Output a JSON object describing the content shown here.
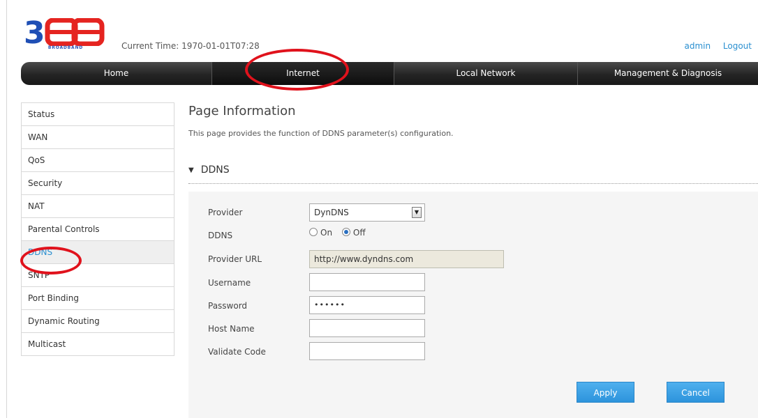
{
  "brand": {
    "logo_text": "3BB",
    "logo_sub": "BROADBAND",
    "colors": {
      "logo_blue": "#1f4fb5",
      "logo_red": "#e52420"
    }
  },
  "header": {
    "current_time": "Current Time: 1970-01-01T07:28",
    "admin": "admin",
    "logout": "Logout"
  },
  "nav": [
    {
      "label": "Home"
    },
    {
      "label": "Internet"
    },
    {
      "label": "Local Network"
    },
    {
      "label": "Management & Diagnosis"
    }
  ],
  "sidebar": {
    "items": [
      {
        "label": "Status"
      },
      {
        "label": "WAN"
      },
      {
        "label": "QoS"
      },
      {
        "label": "Security"
      },
      {
        "label": "NAT"
      },
      {
        "label": "Parental Controls"
      },
      {
        "label": "DDNS"
      },
      {
        "label": "SNTP"
      },
      {
        "label": "Port Binding"
      },
      {
        "label": "Dynamic Routing"
      },
      {
        "label": "Multicast"
      }
    ]
  },
  "main": {
    "heading": "Page Information",
    "description": "This page provides the function of DDNS parameter(s) configuration.",
    "section_title": "DDNS",
    "form": {
      "provider_label": "Provider",
      "provider_value": "DynDNS",
      "ddns_label": "DDNS",
      "ddns_on": "On",
      "ddns_off": "Off",
      "provider_url_label": "Provider URL",
      "provider_url_value": "http://www.dyndns.com",
      "username_label": "Username",
      "username_value": "",
      "password_label": "Password",
      "password_value": "••••••",
      "hostname_label": "Host Name",
      "hostname_value": "",
      "validate_label": "Validate Code",
      "validate_value": ""
    },
    "apply": "Apply",
    "cancel": "Cancel"
  },
  "colors": {
    "accent": "#2a8fd0",
    "annotation": "#e0121c"
  }
}
